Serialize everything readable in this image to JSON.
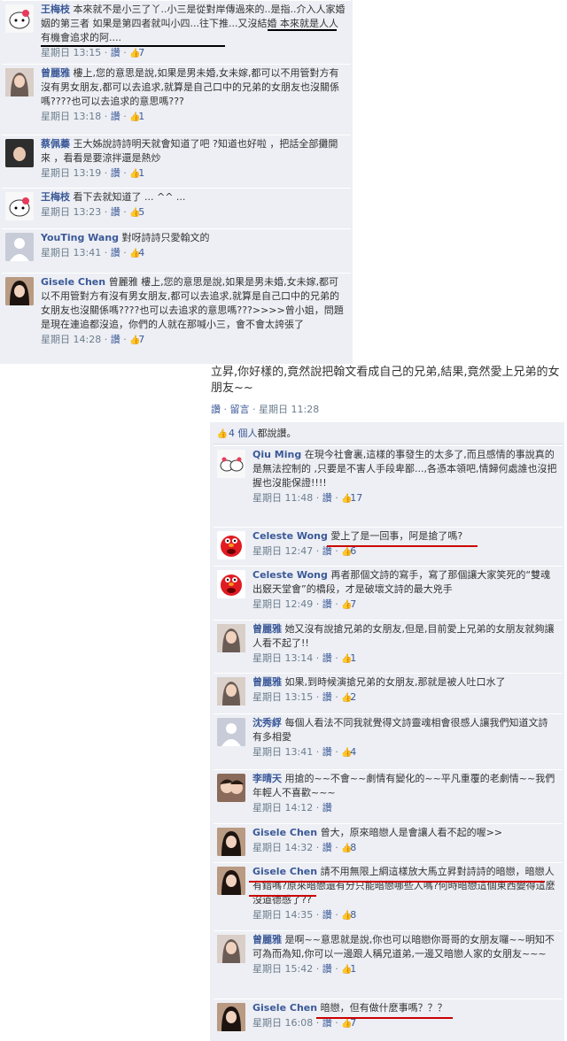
{
  "top_comments": [
    {
      "author": "王梅枝",
      "avatar": "hello-kitty-avatar",
      "text": "本來就不是小三了丫..小三是從對岸傳過來的..是指..介入人家婚姻的第三者 如果是第四者就叫小四...往下推...又沒結婚 本來就是人人有機會追求的阿....",
      "time": "星期日 13:15",
      "like_action": "讚",
      "likes": "7"
    },
    {
      "author": "曾麗雅",
      "avatar": "woman-avatar",
      "text": "樓上,您的意思是說,如果是男未婚,女未嫁,都可以不用管對方有沒有男女朋友,都可以去追求,就算是自己口中的兄弟的女朋友也沒關係嗎????也可以去追求的意思嗎???",
      "time": "星期日 13:18",
      "like_action": "讚",
      "likes": "1"
    },
    {
      "author": "蔡佩蓁",
      "avatar": "woman-avatar",
      "text": "王大姊說詩詩明天就會知道了吧 ?知道也好啦 ，把話全部攤開來 ，看看是要涼拌還是熱炒",
      "time": "星期日 13:19",
      "like_action": "讚",
      "likes": "1"
    },
    {
      "author": "王梅枝",
      "avatar": "hello-kitty-avatar",
      "text": "看下去就知道了 ... ^^ ...",
      "time": "星期日 13:23",
      "like_action": "讚",
      "likes": "5"
    },
    {
      "author": "YouTing Wang",
      "avatar": "default-avatar",
      "text": "對呀詩詩只愛翰文的",
      "time": "星期日 13:41",
      "like_action": "讚",
      "likes": "4"
    },
    {
      "author": "Gisele Chen",
      "avatar": "woman-avatar",
      "text": "曾麗雅 樓上,您的意思是說,如果是男未婚,女未嫁,都可以不用管對方有沒有男女朋友,都可以去追求,就算是自己口中的兄弟的女朋友也沒關係嗎????也可以去追求的意思嗎???>>>>曾小姐，問題是現在連追都沒追，你們的人就在那喊小三，會不會太誇張了",
      "time": "星期日 14:28",
      "like_action": "讚",
      "likes": "7"
    }
  ],
  "post": {
    "text": "立昇,你好樣的,竟然說把翰文看成自己的兄弟,結果,竟然愛上兄弟的女朋友~~",
    "like_action": "讚",
    "comment_action": "留言",
    "time": "星期日 11:28",
    "likes_summary_count": "4 個人",
    "likes_summary_suffix": "都說讚。"
  },
  "bottom_comments": [
    {
      "author": "Qiu Ming",
      "avatar": "hello-kitty-avatar",
      "text": "在現今社會裏,這樣的事發生的太多了,而且感情的事說真的是無法控制的 ,只要是不害人手段卑鄙...,各憑本領吧,情歸何處誰也沒把握也沒能保證!!!!",
      "time": "星期日 11:48",
      "like_action": "讚",
      "likes": "17"
    },
    {
      "author": "Celeste Wong",
      "avatar": "elmo-avatar",
      "text": "愛上了是一回事，阿是搶了嗎?",
      "time": "星期日 12:47",
      "like_action": "讚",
      "likes": "6"
    },
    {
      "author": "Celeste Wong",
      "avatar": "elmo-avatar",
      "text": "再者那個文詩的寫手，寫了那個讓大家笑死的“雙魂出竅天堂會”的橋段，才是破壞文詩的最大兇手",
      "time": "星期日 12:49",
      "like_action": "讚",
      "likes": "7"
    },
    {
      "author": "曾麗雅",
      "avatar": "woman-avatar",
      "text": "她又沒有說搶兄弟的女朋友,但是,目前愛上兄弟的女朋友就夠讓人看不起了!!",
      "time": "星期日 13:14",
      "like_action": "讚",
      "likes": "1"
    },
    {
      "author": "曾麗雅",
      "avatar": "woman-avatar",
      "text": "如果,到時候演搶兄弟的女朋友,那就是被人吐口水了",
      "time": "星期日 13:15",
      "like_action": "讚",
      "likes": "2"
    },
    {
      "author": "沈秀綒",
      "avatar": "default-avatar",
      "text": "每個人看法不同我就覺得文詩靈魂相會很感人讓我們知道文詩有多相愛",
      "time": "星期日 13:41",
      "like_action": "讚",
      "likes": "4"
    },
    {
      "author": "李晴天",
      "avatar": "couple-avatar",
      "text": "用搶的~~不會~~劇情有變化的~~平凡重覆的老劇情~~我們年輕人不喜歡~~~",
      "time": "星期日 14:12",
      "like_action": "讚",
      "likes": ""
    },
    {
      "author": "Gisele Chen",
      "avatar": "woman-avatar",
      "text": "曾大，原來暗戀人是會讓人看不起的喔>>",
      "time": "星期日 14:32",
      "like_action": "讚",
      "likes": "8"
    },
    {
      "author": "Gisele Chen",
      "avatar": "woman-avatar",
      "text": "請不用無限上綱這樣放大馬立昇對詩詩的暗戀，暗戀人有錯嗎?原來暗戀還有分只能暗戀哪些人嗎?何時暗戀這個東西變得這麼沒道德感了??",
      "time": "星期日 14:35",
      "like_action": "讚",
      "likes": "8"
    },
    {
      "author": "曾麗雅",
      "avatar": "woman-avatar",
      "text": "是啊~~意思就是說,你也可以暗戀你哥哥的女朋友囉~~明知不可為而為知,你可以一邊跟人稱兄道弟,一邊又暗戀人家的女朋友~~~",
      "time": "星期日 15:42",
      "like_action": "讚",
      "likes": "1"
    },
    {
      "author": "Gisele Chen",
      "avatar": "woman-avatar",
      "text": "暗戀，但有做什麼事嗎？？？",
      "time": "星期日 16:08",
      "like_action": "讚",
      "likes": "7"
    }
  ],
  "colors": {
    "link": "#3b5998",
    "meta": "#6b7d8d",
    "panel": "#edeff4",
    "underline_black": "#000000",
    "underline_red": "#cc0000"
  }
}
